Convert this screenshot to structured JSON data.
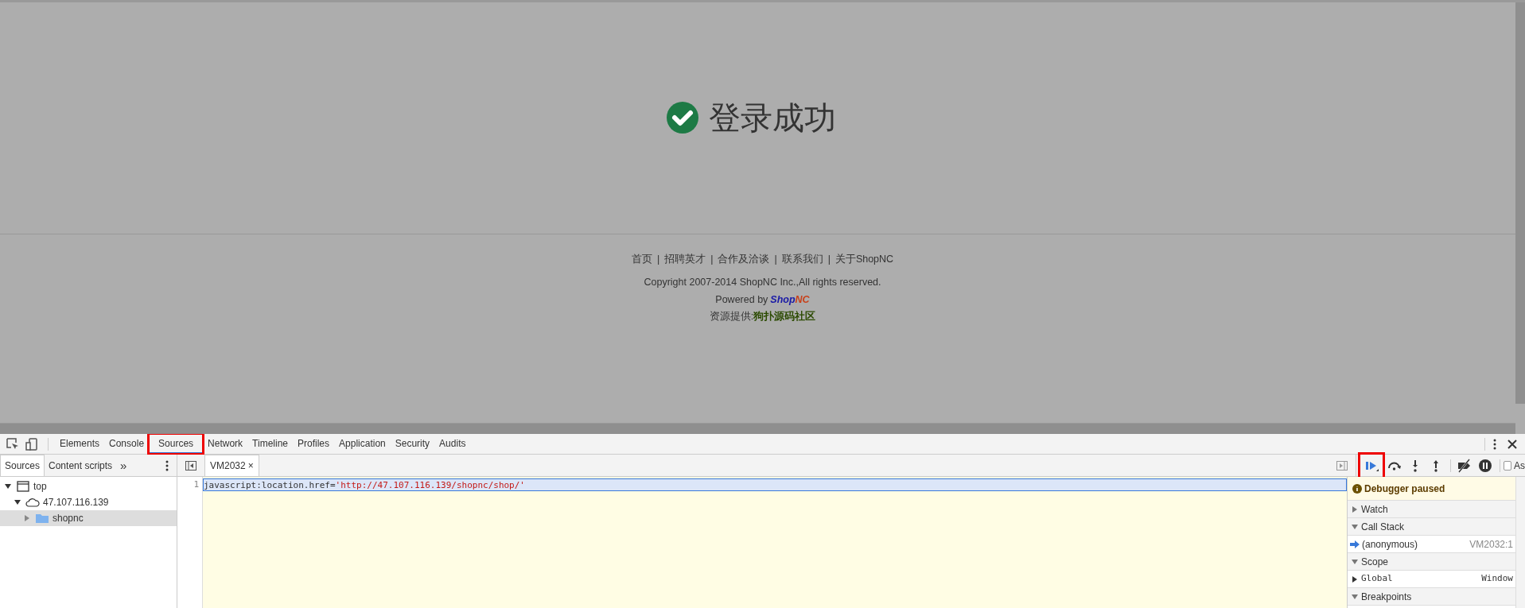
{
  "page": {
    "message": "登录成功",
    "footer_links": [
      "首页",
      "招聘英才",
      "合作及洽谈",
      "联系我们",
      "关于ShopNC"
    ],
    "separator": "|",
    "copyright": "Copyright 2007-2014 ShopNC Inc.,All rights reserved.",
    "powered_by": {
      "label": "Powered by",
      "brand_first": "Shop",
      "brand_second": "NC"
    },
    "resource": {
      "label": "资源提供:",
      "link": "狗扑源码社区"
    }
  },
  "devtools": {
    "tabs": [
      {
        "label": "Elements",
        "selected": false,
        "highlighted": false
      },
      {
        "label": "Console",
        "selected": false,
        "highlighted": false
      },
      {
        "label": "Sources",
        "selected": true,
        "highlighted": true
      },
      {
        "label": "Network",
        "selected": false,
        "highlighted": false
      },
      {
        "label": "Timeline",
        "selected": false,
        "highlighted": false
      },
      {
        "label": "Profiles",
        "selected": false,
        "highlighted": false
      },
      {
        "label": "Application",
        "selected": false,
        "highlighted": false
      },
      {
        "label": "Security",
        "selected": false,
        "highlighted": false
      },
      {
        "label": "Audits",
        "selected": false,
        "highlighted": false
      }
    ],
    "navigator_tabs": [
      {
        "label": "Sources",
        "selected": true
      },
      {
        "label": "Content scripts",
        "selected": false
      }
    ],
    "more": "»",
    "tree": [
      {
        "label": "top",
        "kind": "frame",
        "expanded": true,
        "selected": false,
        "children": [
          {
            "label": "47.107.116.139",
            "kind": "domain",
            "expanded": true,
            "selected": false,
            "children": [
              {
                "label": "shopnc",
                "kind": "folder",
                "expanded": false,
                "selected": true
              }
            ]
          }
        ]
      }
    ],
    "editor_tabs": [
      {
        "label": "VM2032",
        "close": "×"
      }
    ],
    "code_lines": [
      {
        "number": "1",
        "code": "javascript:location.href=",
        "string": "'http://47.107.116.139/shopnc/shop/'",
        "selected": true
      }
    ],
    "debugger_controls": [
      {
        "kind": "resume",
        "highlighted": true
      },
      {
        "kind": "step-over",
        "highlighted": false
      },
      {
        "kind": "step-into",
        "highlighted": false
      },
      {
        "kind": "step-out",
        "highlighted": false
      },
      {
        "kind": "deactivate",
        "highlighted": false
      },
      {
        "kind": "pause-exceptions",
        "highlighted": false
      }
    ],
    "async": {
      "label": "As",
      "checked": false
    },
    "status": "Debugger paused",
    "sections": [
      {
        "title": "Watch",
        "expanded": false
      },
      {
        "title": "Call Stack",
        "expanded": true,
        "entries": [
          {
            "kind": "frame",
            "name": "(anonymous)",
            "value": "VM2032:1",
            "current": true
          }
        ]
      },
      {
        "title": "Scope",
        "expanded": true,
        "entries": [
          {
            "kind": "scope",
            "name": "Global",
            "value": "Window",
            "current": false
          }
        ]
      },
      {
        "title": "Breakpoints",
        "expanded": true
      }
    ]
  }
}
